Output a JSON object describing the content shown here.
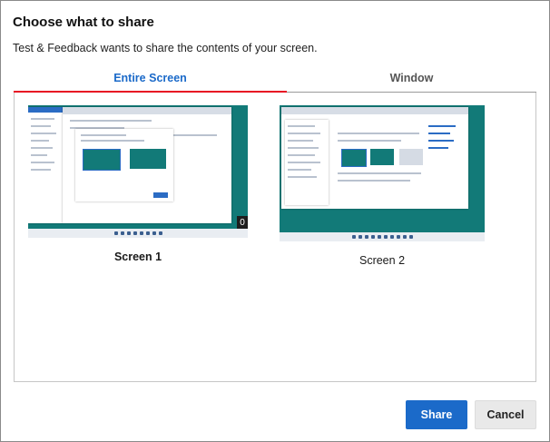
{
  "dialog": {
    "title": "Choose what to share",
    "subtitle": "Test & Feedback wants to share the contents of your screen."
  },
  "tabs": [
    {
      "label": "Entire Screen",
      "active": true
    },
    {
      "label": "Window",
      "active": false
    }
  ],
  "screens": [
    {
      "label": "Screen 1",
      "selected": true,
      "badge": "0"
    },
    {
      "label": "Screen 2",
      "selected": false
    }
  ],
  "buttons": {
    "share": "Share",
    "cancel": "Cancel"
  },
  "colors": {
    "accent": "#1b6ac9",
    "tab_underline": "#e81123",
    "desktop_bg": "#127a78"
  }
}
